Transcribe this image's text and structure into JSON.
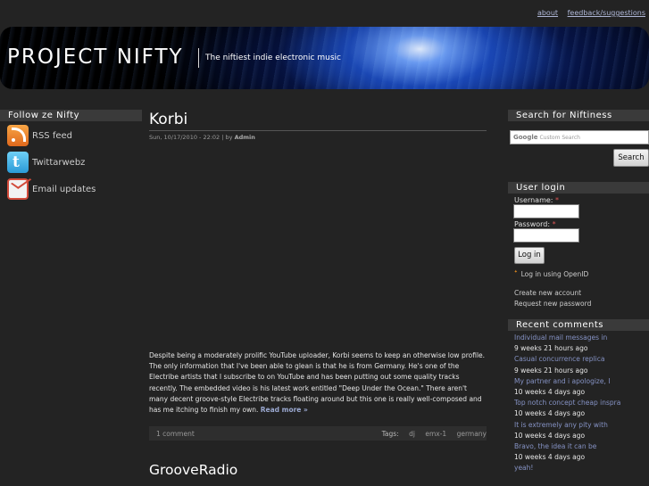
{
  "top_links": {
    "about": "about",
    "feedback": "feedback/suggestions"
  },
  "header": {
    "site_name": "PROJECT NIFTY",
    "slogan": "The niftiest indie electronic music"
  },
  "left_sidebar": {
    "title": "Follow ze Nifty",
    "items": [
      {
        "label": "RSS feed",
        "icon": "rss-icon"
      },
      {
        "label": "Twittarwebz",
        "icon": "twitter-icon"
      },
      {
        "label": "Email updates",
        "icon": "email-icon"
      }
    ]
  },
  "posts": [
    {
      "title": "Korbi",
      "date": "Sun, 10/17/2010 - 22:02",
      "by_prefix": "| by",
      "author": "Admin",
      "body": "Despite being a moderately prolific YouTube uploader, Korbi seems to keep an otherwise low profile. The only information that I've been able to glean is that he is from Germany. He's one of the Electribe artists that I subscribe to on YouTube and has been putting out some quality tracks recently. The embedded video is his latest work entitled \"Deep Under the Ocean.\" There aren't many decent groove-style Electribe tracks floating around but this one is really well-composed and has me itching to finish my own.",
      "read_more": "Read more »",
      "comments": "1 comment",
      "tags_label": "Tags:",
      "tags": [
        "dj",
        "emx-1",
        "germany"
      ]
    },
    {
      "title": "GrooveRadio"
    }
  ],
  "search": {
    "title": "Search for Niftiness",
    "google": "Google",
    "placeholder": "Custom Search",
    "button": "Search"
  },
  "login": {
    "title": "User login",
    "username_label": "Username:",
    "password_label": "Password:",
    "required_mark": "*",
    "button": "Log in",
    "openid": "Log in using OpenID",
    "create_account": "Create new account",
    "request_password": "Request new password"
  },
  "recent_comments": {
    "title": "Recent comments",
    "items": [
      {
        "link": "Individual mail messages in",
        "time": "9 weeks 21 hours ago"
      },
      {
        "link": "Casual concurrence replica",
        "time": "9 weeks 21 hours ago"
      },
      {
        "link": "My partner and i apologize, I",
        "time": "10 weeks 4 days ago"
      },
      {
        "link": "Top notch concept cheap inspra",
        "time": "10 weeks 4 days ago"
      },
      {
        "link": "It is extremely any pity with",
        "time": "10 weeks 4 days ago"
      },
      {
        "link": "Bravo, the idea it can be",
        "time": "10 weeks 4 days ago"
      },
      {
        "link": "yeah!",
        "time": ""
      }
    ]
  },
  "colors": {
    "background": "#232323",
    "block_title_bg": "#3a3a3a",
    "link": "#8592c4"
  }
}
